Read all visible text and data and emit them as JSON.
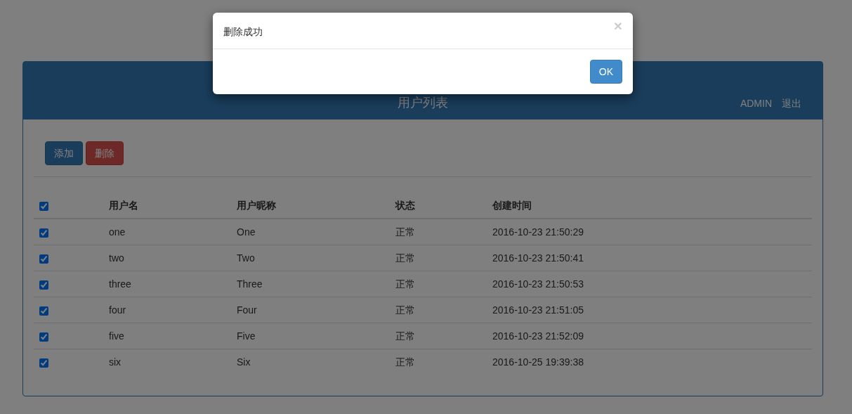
{
  "panel": {
    "title": "用户列表",
    "user": "ADMIN",
    "logout": "退出"
  },
  "toolbar": [
    {
      "label": "添加",
      "kind": "primary"
    },
    {
      "label": "删除",
      "kind": "danger"
    }
  ],
  "table": {
    "select_all": {
      "checked": true
    },
    "columns": [
      "用户名",
      "用户昵称",
      "状态",
      "创建时间"
    ],
    "rows": [
      {
        "checked": true,
        "cells": [
          "one",
          "One",
          "正常",
          "2016-10-23 21:50:29"
        ]
      },
      {
        "checked": true,
        "cells": [
          "two",
          "Two",
          "正常",
          "2016-10-23 21:50:41"
        ]
      },
      {
        "checked": true,
        "cells": [
          "three",
          "Three",
          "正常",
          "2016-10-23 21:50:53"
        ]
      },
      {
        "checked": true,
        "cells": [
          "four",
          "Four",
          "正常",
          "2016-10-23 21:51:05"
        ]
      },
      {
        "checked": true,
        "cells": [
          "five",
          "Five",
          "正常",
          "2016-10-23 21:52:09"
        ]
      },
      {
        "checked": true,
        "cells": [
          "six",
          "Six",
          "正常",
          "2016-10-25 19:39:38"
        ]
      }
    ]
  },
  "modal": {
    "title": "删除成功",
    "close": "×",
    "button": "OK"
  }
}
